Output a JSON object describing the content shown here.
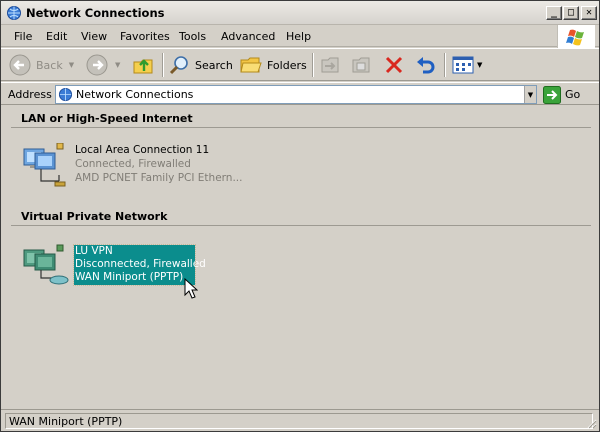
{
  "window": {
    "title": "Network Connections",
    "controls": {
      "minimize": "_",
      "maximize": "□",
      "close": "✕"
    }
  },
  "menu": {
    "items": [
      "File",
      "Edit",
      "View",
      "Favorites",
      "Tools",
      "Advanced",
      "Help"
    ]
  },
  "toolbar": {
    "back_label": "Back",
    "search_label": "Search",
    "folders_label": "Folders"
  },
  "address": {
    "label": "Address",
    "value": "Network Connections",
    "go_label": "Go"
  },
  "groups": [
    {
      "title": "LAN or High-Speed Internet",
      "connections": [
        {
          "name": "Local Area Connection 11",
          "status": "Connected, Firewalled",
          "device": "AMD PCNET Family PCI Ethern..."
        }
      ]
    },
    {
      "title": "Virtual Private Network",
      "connections": [
        {
          "name": "LU VPN",
          "status": "Disconnected, Firewalled",
          "device": "WAN Miniport (PPTP)",
          "selected": true
        }
      ]
    }
  ],
  "statusbar": {
    "text": "WAN Miniport (PPTP)"
  },
  "colors": {
    "selection": "#0b8d8d",
    "face": "#d4d0c8"
  }
}
